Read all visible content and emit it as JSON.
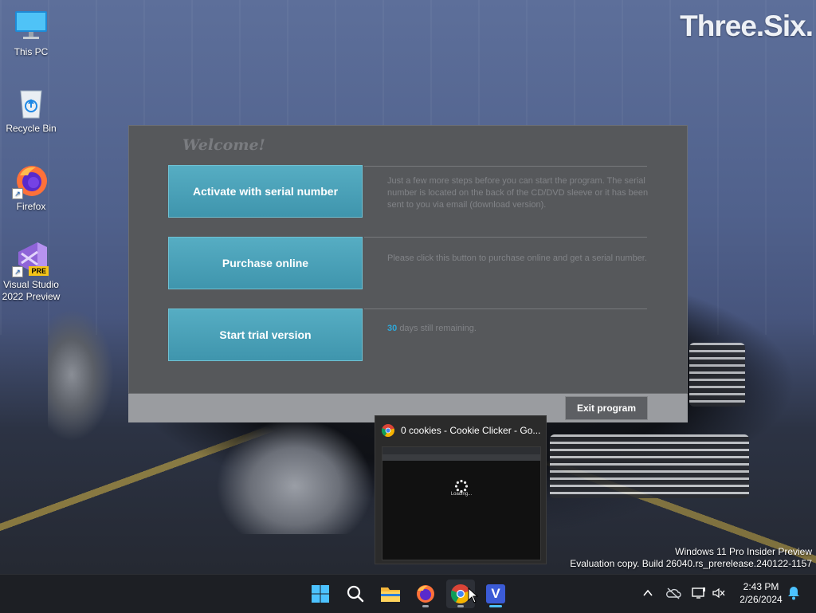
{
  "wallpaper": {
    "brand_text": "Three.Six."
  },
  "desktop_icons": [
    {
      "label": "This PC",
      "icon": "this-pc-icon"
    },
    {
      "label": "Recycle Bin",
      "icon": "recycle-bin-icon"
    },
    {
      "label": "Firefox",
      "icon": "firefox-icon"
    },
    {
      "label": "Visual Studio 2022 Preview",
      "icon": "visual-studio-icon",
      "badge": "PRE"
    }
  ],
  "dialog": {
    "welcome": "Welcome!",
    "options": [
      {
        "label": "Activate with serial number",
        "description": "Just a few more steps before you can start the program. The serial number is located on the back of the CD/DVD sleeve or it has been sent to you via email (download version)."
      },
      {
        "label": "Purchase online",
        "description": "Please click this button to purchase online and get a serial number."
      },
      {
        "label": "Start trial version",
        "days": "30",
        "description_suffix": "days still remaining."
      }
    ],
    "exit_label": "Exit program"
  },
  "watermark": {
    "line1": "Windows 11 Pro Insider Preview",
    "line2": "Evaluation copy. Build 26040.rs_prerelease.240122-1157"
  },
  "thumbnail": {
    "title": "0 cookies - Cookie Clicker - Go...",
    "loading_text": "Loading..."
  },
  "taskbar": {
    "apps": [
      "start-icon",
      "search-icon",
      "file-explorer-icon",
      "firefox-icon",
      "chrome-icon",
      "veeam-icon"
    ],
    "veeam_letter": "V",
    "tray": [
      "chevron-up-icon",
      "onedrive-icon",
      "network-icon",
      "volume-muted-icon"
    ],
    "time": "2:43 PM",
    "date": "2/26/2024",
    "accent": "#4cc2ff"
  },
  "colors": {
    "dialog_bg": "#56585b",
    "button_teal": "#4aa2b9",
    "days_accent": "#2ea7d8"
  }
}
